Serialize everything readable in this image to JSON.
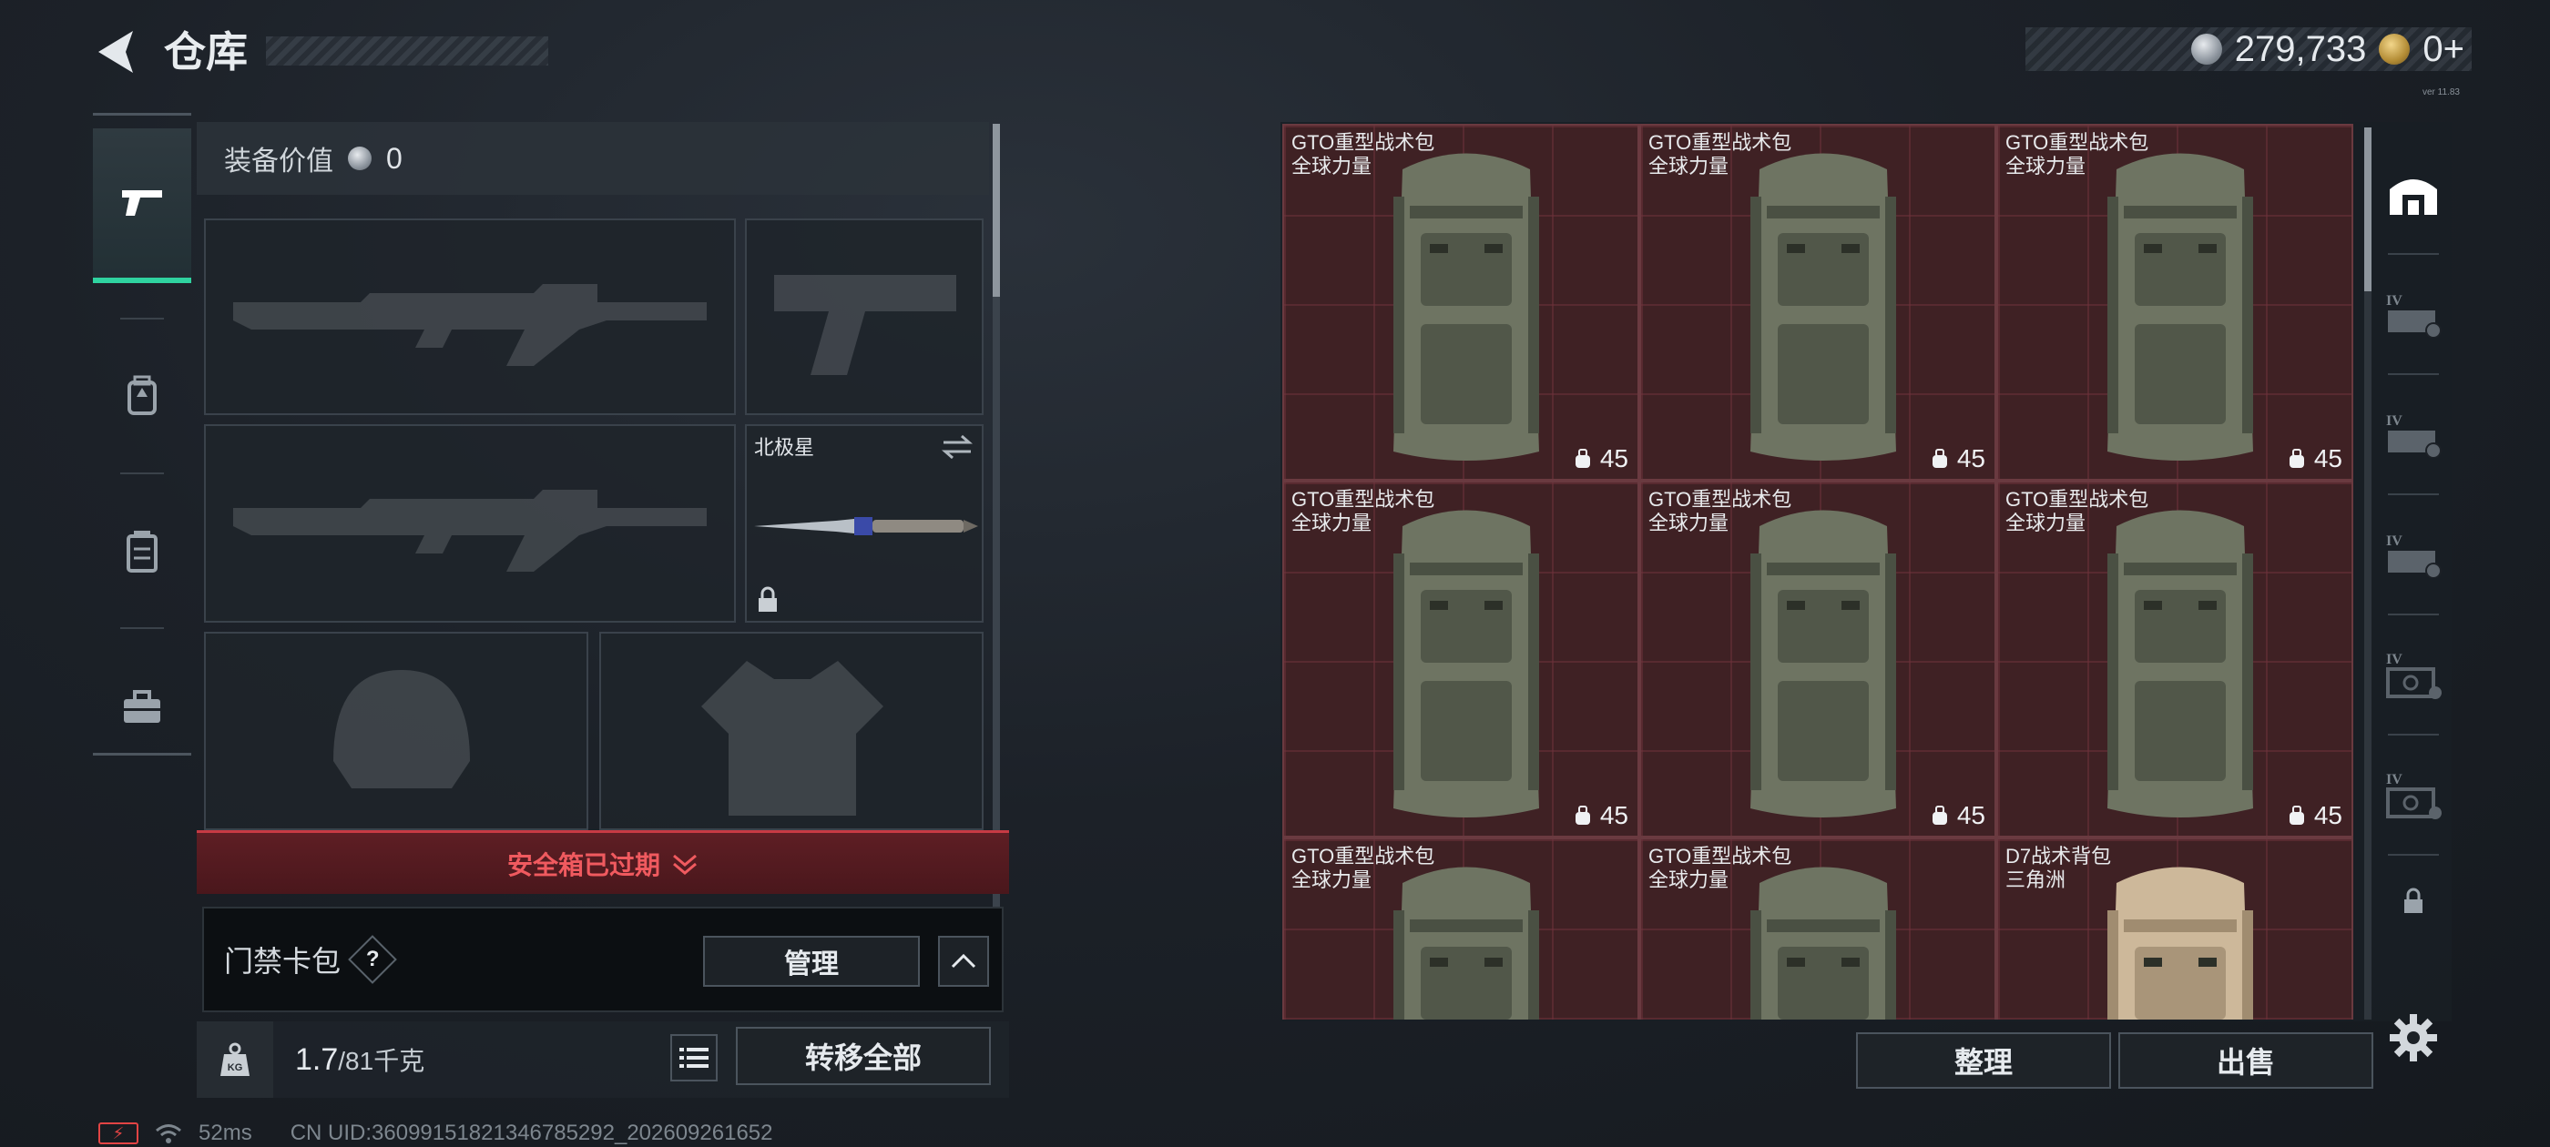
{
  "header": {
    "title": "仓库",
    "currency": [
      {
        "icon": "silver-coin-icon",
        "value": "279,733"
      },
      {
        "icon": "gold-triangle-icon",
        "value": "0+"
      }
    ],
    "version": "ver 11.83"
  },
  "left_tabs": [
    {
      "name": "pistol-icon",
      "active": true
    },
    {
      "name": "backpack-tab-icon",
      "active": false
    },
    {
      "name": "vest-tab-icon",
      "active": false
    },
    {
      "name": "toolbox-icon",
      "active": false
    }
  ],
  "equipment": {
    "value_label": "装备价值",
    "value": "0",
    "knife_slot_label": "北极星",
    "safebox_expired": "安全箱已过期",
    "keycard_label": "门禁卡包",
    "help_label": "?",
    "manage_label": "管理",
    "weight_current": "1.7",
    "weight_max": "/81千克",
    "transfer_all_label": "转移全部"
  },
  "grid_items": [
    {
      "name": "GTO重型战术包",
      "sub": "全球力量",
      "durability": "45",
      "variant": "green"
    },
    {
      "name": "GTO重型战术包",
      "sub": "全球力量",
      "durability": "45",
      "variant": "green"
    },
    {
      "name": "GTO重型战术包",
      "sub": "全球力量",
      "durability": "45",
      "variant": "green"
    },
    {
      "name": "GTO重型战术包",
      "sub": "全球力量",
      "durability": "45",
      "variant": "green"
    },
    {
      "name": "GTO重型战术包",
      "sub": "全球力量",
      "durability": "45",
      "variant": "green"
    },
    {
      "name": "GTO重型战术包",
      "sub": "全球力量",
      "durability": "45",
      "variant": "green"
    },
    {
      "name": "GTO重型战术包",
      "sub": "全球力量",
      "durability": "",
      "variant": "green"
    },
    {
      "name": "GTO重型战术包",
      "sub": "全球力量",
      "durability": "",
      "variant": "green"
    },
    {
      "name": "D7战术背包",
      "sub": "三角洲",
      "durability": "",
      "variant": "tan"
    }
  ],
  "actions": {
    "sort_label": "整理",
    "sell_label": "出售"
  },
  "status_bar": {
    "ping": "52ms",
    "uid": "CN UID:3609915182134678529​2_202609261652"
  },
  "colors": {
    "accent": "#2fd3a0",
    "danger": "#f05a5f",
    "cell_bg": "#3f2124"
  }
}
